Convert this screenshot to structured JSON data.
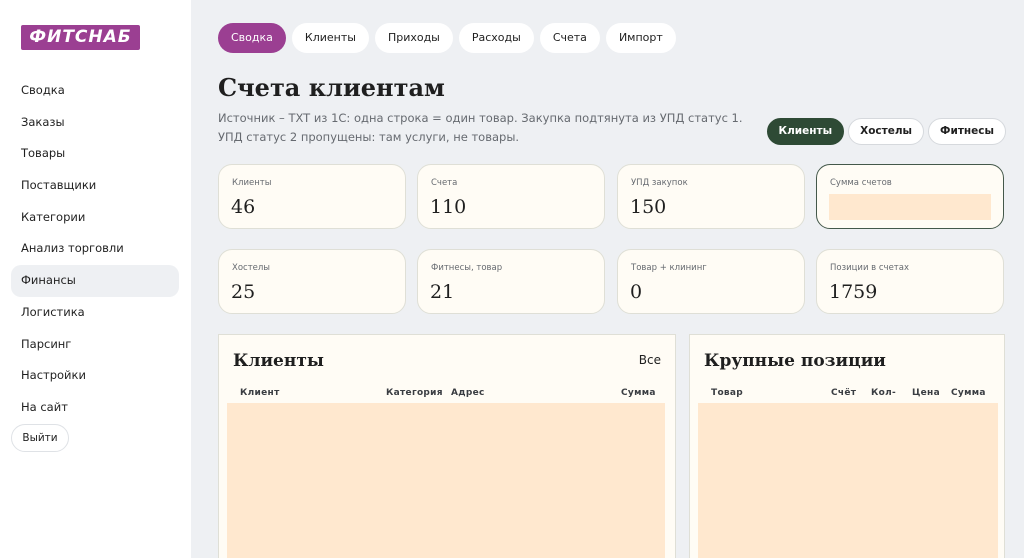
{
  "sidebar": {
    "logo": "ФИТСНАБ",
    "items": [
      {
        "label": "Сводка"
      },
      {
        "label": "Заказы"
      },
      {
        "label": "Товары"
      },
      {
        "label": "Поставщики"
      },
      {
        "label": "Категории"
      },
      {
        "label": "Анализ торговли"
      },
      {
        "label": "Финансы",
        "active": true
      },
      {
        "label": "Логистика"
      },
      {
        "label": "Парсинг"
      },
      {
        "label": "Настройки"
      },
      {
        "label": "На сайт"
      }
    ],
    "logout": "Выйти"
  },
  "tabs": [
    {
      "label": "Сводка",
      "active": true
    },
    {
      "label": "Клиенты"
    },
    {
      "label": "Приходы"
    },
    {
      "label": "Расходы"
    },
    {
      "label": "Счета"
    },
    {
      "label": "Импорт"
    }
  ],
  "page": {
    "title": "Счета клиентам",
    "subtitle": "Источник – TXT из 1С: одна строка = один товар. Закупка подтянута из УПД статус 1. УПД статус 2 пропущены: там услуги, не товары."
  },
  "filters": [
    {
      "label": "Клиенты",
      "active": true
    },
    {
      "label": "Хостелы"
    },
    {
      "label": "Фитнесы"
    }
  ],
  "stats": {
    "clients": {
      "label": "Клиенты",
      "value": "46"
    },
    "invoices": {
      "label": "Счета",
      "value": "110"
    },
    "upd": {
      "label": "УПД закупок",
      "value": "150"
    },
    "sum": {
      "label": "Сумма счетов",
      "value": ""
    },
    "hostels": {
      "label": "Хостелы",
      "value": "25"
    },
    "fitness": {
      "label": "Фитнесы, товар",
      "value": "21"
    },
    "cleaning": {
      "label": "Товар + клининг",
      "value": "0"
    },
    "positions": {
      "label": "Позиции в счетах",
      "value": "1759"
    }
  },
  "clients_panel": {
    "title": "Клиенты",
    "link": "Все",
    "columns": {
      "client": "Клиент",
      "category": "Категория",
      "address": "Адрес",
      "sum": "Сумма"
    }
  },
  "positions_panel": {
    "title": "Крупные позиции",
    "columns": {
      "product": "Товар",
      "invoice": "Счёт",
      "qty": "Кол-",
      "price": "Цена",
      "sum": "Сумма"
    }
  },
  "colors": {
    "accent": "#9b3f92",
    "filter_active": "#2e4a35",
    "card_bg": "#fffcf5",
    "placeholder": "#ffe8cf",
    "page_bg": "#eef0f3"
  }
}
